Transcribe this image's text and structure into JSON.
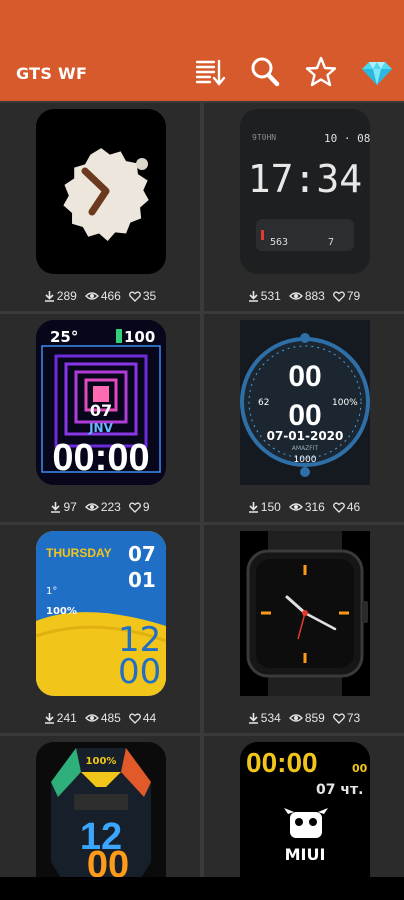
{
  "app": {
    "title": "GTS WF"
  },
  "toolbar": {
    "icons": [
      "sort-download-icon",
      "search-icon",
      "star-icon",
      "diamond-icon"
    ]
  },
  "colors": {
    "header": "#d65a2c",
    "background": "#3a3a3a",
    "cell": "#2b2b2b"
  },
  "faces": [
    {
      "downloads": "289",
      "views": "466",
      "likes": "35"
    },
    {
      "downloads": "531",
      "views": "883",
      "likes": "79"
    },
    {
      "downloads": "97",
      "views": "223",
      "likes": "9"
    },
    {
      "downloads": "150",
      "views": "316",
      "likes": "46"
    },
    {
      "downloads": "241",
      "views": "485",
      "likes": "44"
    },
    {
      "downloads": "534",
      "views": "859",
      "likes": "73"
    }
  ],
  "face_text": {
    "f2": {
      "top_left": "9T0HN",
      "date": "10 · 08",
      "time": "17:34",
      "steps": "563",
      "small": "7"
    },
    "f3": {
      "temp": "25°",
      "battery": "100",
      "day": "07",
      "month": "JNV",
      "time": "00:00"
    },
    "f4": {
      "hours": "00",
      "minutes": "00",
      "left": "62",
      "right": "100%",
      "date": "07-01-2020",
      "brand": "AMAZFIT",
      "steps": "1000"
    },
    "f5": {
      "day": "THURSDAY",
      "d1": "07",
      "d2": "01",
      "temp": "1°",
      "pct": "100%",
      "h": "12",
      "m": "00"
    },
    "f7": {
      "battery": "100%",
      "h": "12",
      "m": "00"
    },
    "f8": {
      "time": "00:00",
      "sec": "00",
      "date": "07 чт.",
      "brand": "MIUI"
    }
  }
}
